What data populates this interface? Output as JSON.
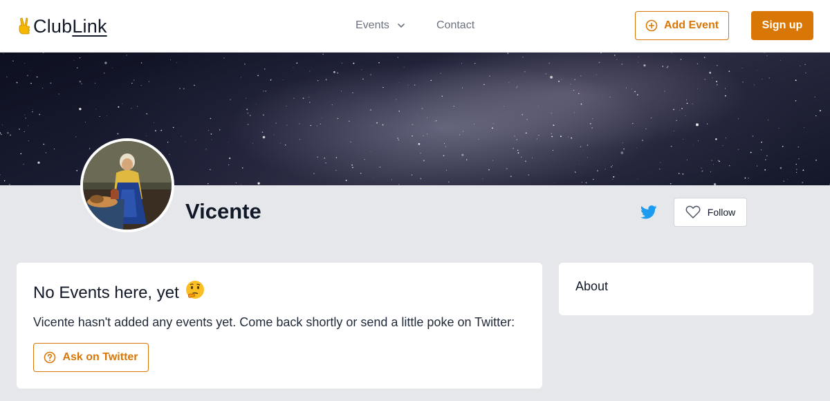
{
  "header": {
    "logo_text_1": "Club",
    "logo_text_2": "Link",
    "logo_icon": "victory-hand-icon",
    "nav": {
      "events_label": "Events",
      "contact_label": "Contact"
    },
    "add_event_label": "Add Event",
    "signup_label": "Sign up"
  },
  "banner": {
    "description_icon": "starry-sky-banner"
  },
  "profile": {
    "name": "Vicente",
    "avatar_icon": "painting-avatar",
    "twitter_icon": "twitter-icon",
    "follow_label": "Follow"
  },
  "events_card": {
    "title": "No Events here, yet",
    "title_emoji": "🤔",
    "message": "Vicente hasn't added any events yet. Come back shortly or send a little poke on Twitter:",
    "ask_button_label": "Ask on Twitter"
  },
  "about_card": {
    "title": "About"
  },
  "colors": {
    "accent": "#d97706",
    "background": "#e5e7eb",
    "twitter": "#1d9bf0"
  }
}
